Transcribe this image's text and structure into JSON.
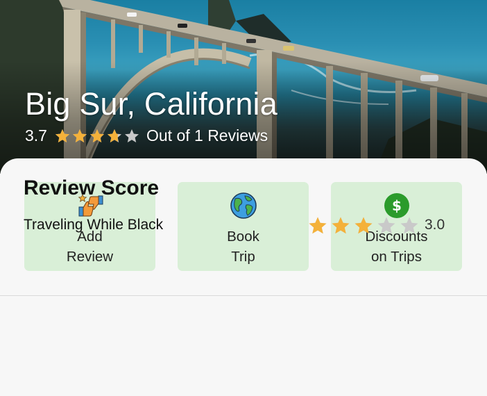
{
  "destination": {
    "title": "Big Sur, California",
    "rating": "3.7",
    "rating_value": 3.7,
    "reviews_text": "Out of 1 Reviews"
  },
  "actions": [
    {
      "line1": "Add",
      "line2": "Review",
      "icon": "thumbs-review-icon"
    },
    {
      "line1": "Book",
      "line2": "Trip",
      "icon": "globe-icon"
    },
    {
      "line1": "Discounts",
      "line2": "on Trips",
      "icon": "dollar-icon"
    }
  ],
  "review_score": {
    "title": "Review Score",
    "items": [
      {
        "label": "Traveling While Black",
        "score": "3.0",
        "score_value": 3.0
      }
    ]
  },
  "colors": {
    "star_filled": "#f4b13a",
    "star_empty": "#c9c9c9",
    "action_bg": "#d9efd7",
    "dollar_green": "#2b9b2b"
  }
}
